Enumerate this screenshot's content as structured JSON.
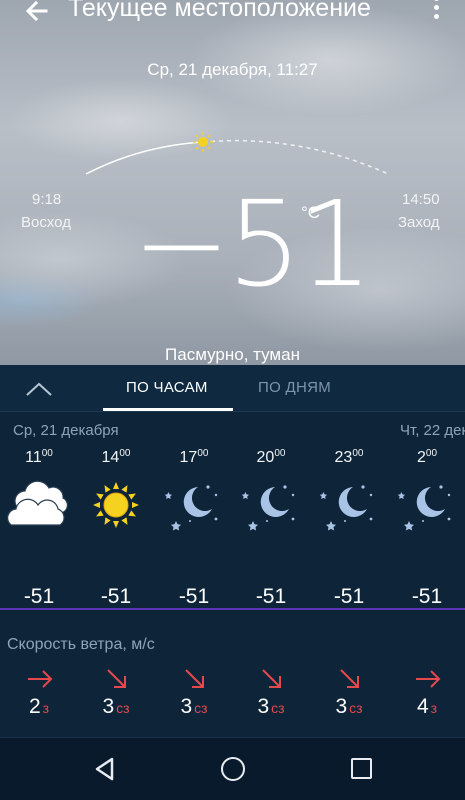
{
  "header": {
    "title": "Текущее местоположение"
  },
  "weather": {
    "datetime": "Ср, 21 декабря, 11:27",
    "sunrise_time": "9:18",
    "sunrise_label": "Восход",
    "sunset_time": "14:50",
    "sunset_label": "Заход",
    "temperature": "−51",
    "unit": "°C",
    "condition": "Пасмурно, туман"
  },
  "tabs": {
    "hourly": "ПО ЧАСАМ",
    "daily": "ПО ДНЯМ",
    "active": "hourly"
  },
  "forecast": {
    "day_left": "Ср, 21 декабря",
    "day_right": "Чт, 22 дек",
    "hours": [
      {
        "hour": "11",
        "minutes": "00",
        "icon": "cloudy-icon",
        "temp": "-51"
      },
      {
        "hour": "14",
        "minutes": "00",
        "icon": "sun-icon",
        "temp": "-51"
      },
      {
        "hour": "17",
        "minutes": "00",
        "icon": "moon-stars-icon",
        "temp": "-51"
      },
      {
        "hour": "20",
        "minutes": "00",
        "icon": "moon-stars-icon",
        "temp": "-51"
      },
      {
        "hour": "23",
        "minutes": "00",
        "icon": "moon-stars-icon",
        "temp": "-51"
      },
      {
        "hour": "2",
        "minutes": "00",
        "icon": "moon-stars-icon",
        "temp": "-51"
      }
    ]
  },
  "wind": {
    "title": "Скорость ветра, м/с",
    "items": [
      {
        "speed": "2",
        "dir": "з",
        "arrow": "east-arrow-icon"
      },
      {
        "speed": "3",
        "dir": "сз",
        "arrow": "southeast-arrow-icon"
      },
      {
        "speed": "3",
        "dir": "сз",
        "arrow": "southeast-arrow-icon"
      },
      {
        "speed": "3",
        "dir": "сз",
        "arrow": "southeast-arrow-icon"
      },
      {
        "speed": "3",
        "dir": "сз",
        "arrow": "southeast-arrow-icon"
      },
      {
        "speed": "4",
        "dir": "з",
        "arrow": "east-arrow-icon"
      }
    ]
  },
  "colors": {
    "panel": "#0e2539",
    "accent_line": "#5a35b8",
    "wind_arrow": "#e5484d",
    "sun": "#f5d21f"
  }
}
